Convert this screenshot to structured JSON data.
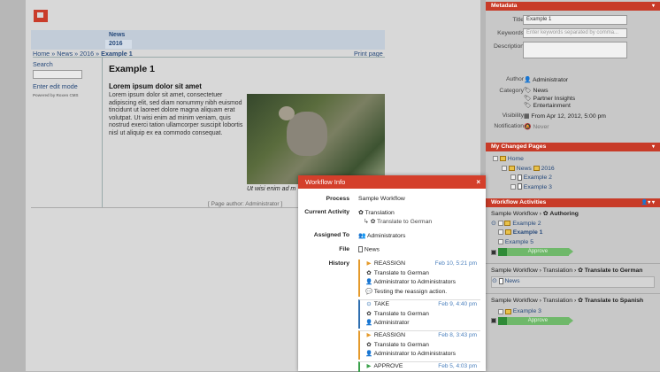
{
  "content": {
    "nav_tabs": [
      "News",
      "2016"
    ],
    "breadcrumb": {
      "home": "Home",
      "sep": "»",
      "news": "News",
      "year": "2016",
      "current": "Example 1"
    },
    "print_label": "Print page",
    "search_label": "Search",
    "edit_mode_label": "Enter edit mode",
    "powered_by": "Powered by Roxen CMS",
    "title": "Example 1",
    "subtitle": "Lorem ipsum dolor sit amet",
    "body": "Lorem ipsum dolor sit amet, consectetuer adipiscing elit, sed diam nonummy nibh euismod tincidunt ut laoreet dolore magna aliquam erat volutpat. Ut wisi enim ad minim veniam, quis nostrud exerci tation ullamcorper suscipit lobortis nisl ut aliquip ex ea commodo consequat.",
    "caption": "Ut wisi enim ad m",
    "page_author": "[ Page author: Administrator ]"
  },
  "metadata": {
    "header": "Metadata",
    "title_label": "Title",
    "title_value": "Example 1",
    "keywords_label": "Keywords",
    "keywords_placeholder": "Enter keywords separated by comma...",
    "description_label": "Description",
    "author_label": "Author",
    "author_value": "Administrator",
    "category_label": "Category",
    "categories": [
      "News",
      "Partner Insights",
      "Entertainment"
    ],
    "visibility_label": "Visibility",
    "visibility_value": "From Apr 12, 2012, 5:00 pm",
    "notification_label": "Notification",
    "notification_value": "Never"
  },
  "changed_pages": {
    "header": "My Changed Pages",
    "items": [
      "Home",
      "News",
      "2016",
      "Example 2",
      "Example 3"
    ]
  },
  "workflow_activities": {
    "header": "Workflow Activities",
    "group1": {
      "title": "Sample Workflow",
      "sep": "›",
      "state": "Authoring",
      "items": [
        "Example 2",
        "Example 1",
        "Example 5"
      ]
    },
    "approve_label": "Approve",
    "group2": {
      "title": "Sample Workflow",
      "sep1": "›",
      "mid": "Translation",
      "sep2": "›",
      "state": "Translate to German",
      "item": "News"
    },
    "group3": {
      "title": "Sample Workflow",
      "sep1": "›",
      "mid": "Translation",
      "sep2": "›",
      "state": "Translate to Spanish",
      "item": "Example 3"
    }
  },
  "workflow_info": {
    "header": "Workflow Info",
    "close": "×",
    "process_label": "Process",
    "process_value": "Sample Workflow",
    "activity_label": "Current Activity",
    "activity_value": "Translation",
    "activity_sub": "Translate to German",
    "assigned_label": "Assigned To",
    "assigned_value": "Administrators",
    "file_label": "File",
    "file_value": "News",
    "history_label": "History",
    "history": [
      {
        "action": "REASSIGN",
        "date": "Feb 10, 5:21 pm",
        "lines": [
          "Translate to German",
          "Administrator to  Administrators",
          "Testing the reassign action."
        ],
        "color": "#e59a2b"
      },
      {
        "action": "TAKE",
        "date": "Feb 9, 4:40 pm",
        "lines": [
          "Translate to German",
          "Administrator"
        ],
        "color": "#2f6fb0"
      },
      {
        "action": "REASSIGN",
        "date": "Feb 8, 3:43 pm",
        "lines": [
          "Translate to German",
          "Administrator to  Administrators"
        ],
        "color": "#e59a2b"
      },
      {
        "action": "APPROVE",
        "date": "Feb 5, 4:03 pm",
        "lines": [],
        "color": "#3aa14a"
      }
    ]
  },
  "colors": {
    "accent": "#c83b28",
    "link": "#274a7b",
    "approve": "#6fb86a"
  }
}
